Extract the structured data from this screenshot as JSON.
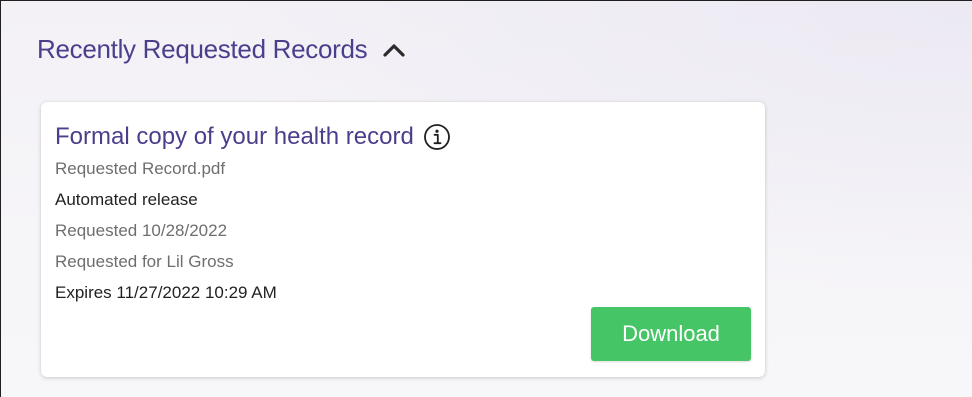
{
  "section": {
    "title": "Recently Requested Records",
    "toggle_icon": "chevron-up-icon"
  },
  "record": {
    "title": "Formal copy of your health record",
    "info_icon": "info-icon",
    "file_name": "Requested Record.pdf",
    "release_type": "Automated release",
    "requested_date": "Requested 10/28/2022",
    "requested_for": "Requested for Lil Gross",
    "expires": "Expires 11/27/2022 10:29 AM",
    "download_label": "Download"
  },
  "colors": {
    "accent": "#4b3f8c",
    "button": "#46c567",
    "muted_text": "#6e6e6e"
  }
}
